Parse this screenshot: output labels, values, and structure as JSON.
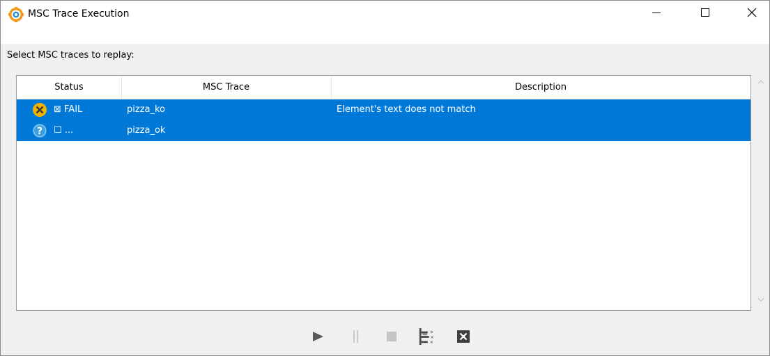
{
  "window": {
    "title": "MSC Trace Execution",
    "app_icon": "app-logo-icon"
  },
  "prompt": "Select MSC traces to replay:",
  "table": {
    "columns": [
      "Status",
      "MSC Trace",
      "Description"
    ],
    "rows": [
      {
        "status_icon": "fail-icon",
        "status_text": "⊠ FAIL",
        "trace": "pizza_ko",
        "description": "Element's text does not match",
        "selected": true
      },
      {
        "status_icon": "question-icon",
        "status_text": "☐ ...",
        "trace": "pizza_ok",
        "description": "",
        "selected": true
      }
    ]
  },
  "toolbar": {
    "buttons": [
      "play-icon",
      "pause-icon",
      "stop-icon",
      "toggle-tree-icon",
      "clear-icon"
    ]
  },
  "colors": {
    "selection": "#0078d7",
    "fail_icon": "#f0b400",
    "question_icon": "#3aa0e0"
  }
}
